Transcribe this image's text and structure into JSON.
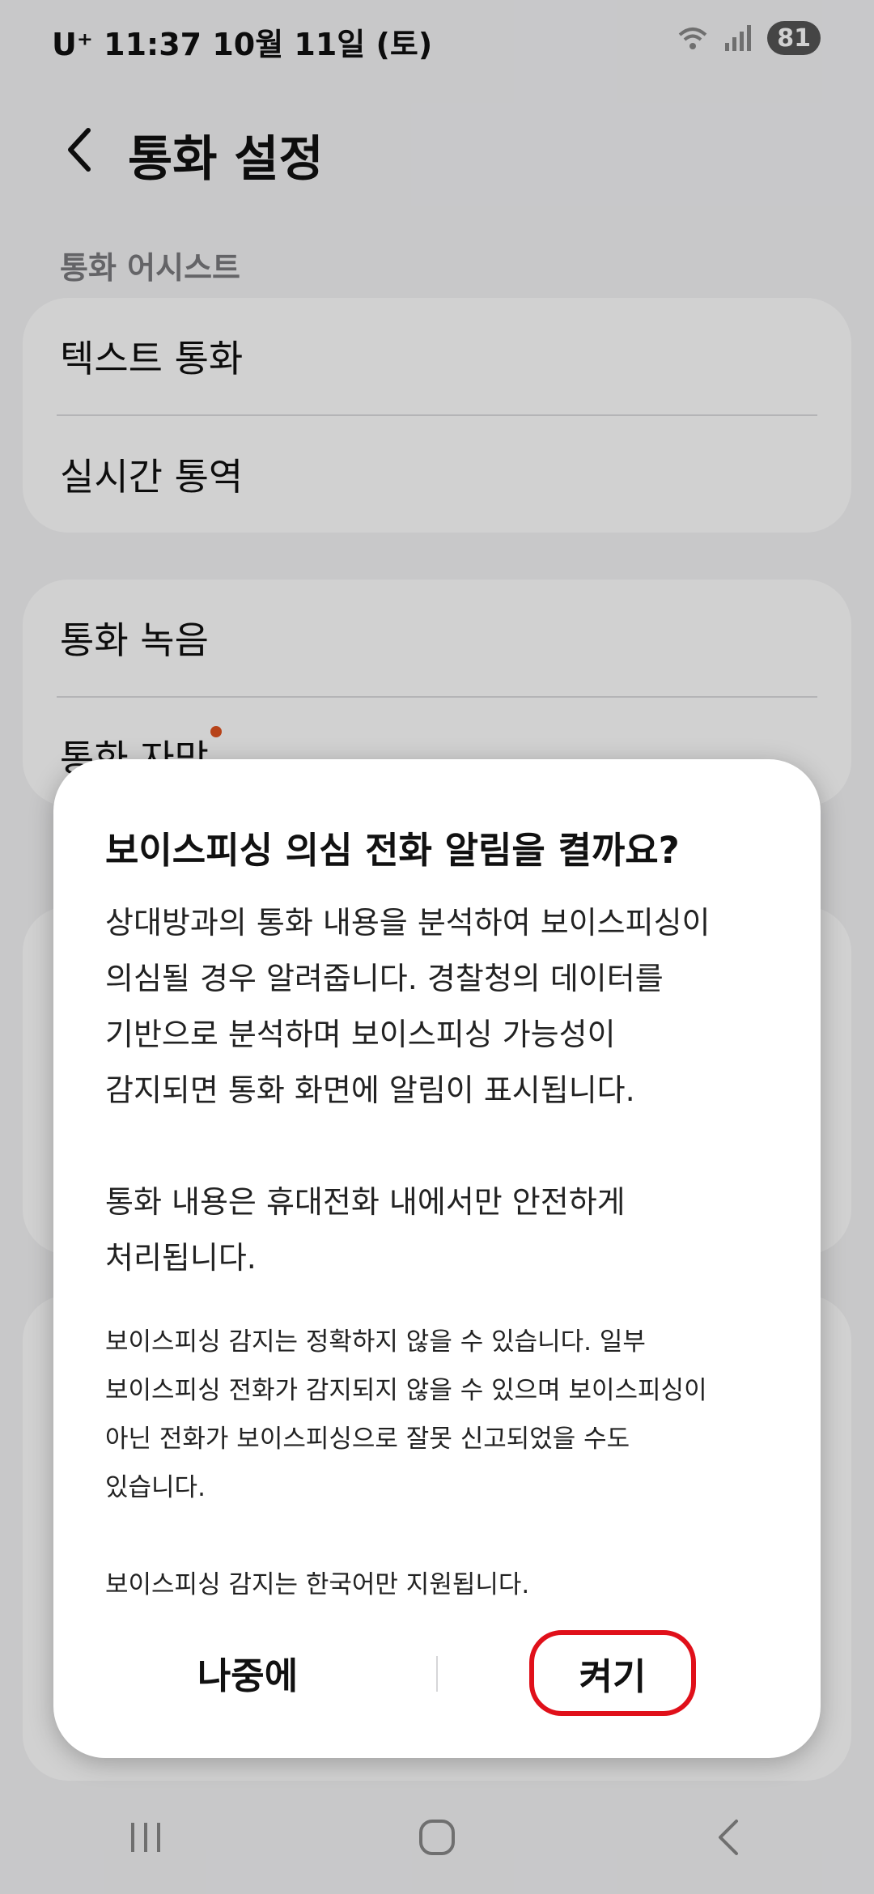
{
  "status_bar": {
    "carrier": "U⁺",
    "time": "11:37",
    "date": "10월 11일 (토)",
    "battery": "81"
  },
  "header": {
    "title": "통화 설정",
    "back_icon": "chevron-left-icon"
  },
  "section": {
    "label": "통화 어시스트"
  },
  "settings_items": [
    {
      "label": "텍스트 통화"
    },
    {
      "label": "실시간 통역"
    },
    {
      "label": "통화 녹음"
    },
    {
      "label": "통화 자막"
    }
  ],
  "dialog": {
    "title": "보이스피싱 의심 전화 알림을 켤까요?",
    "body": [
      "상대방과의 통화 내용을 분석하여 보이스피싱이\n의심될 경우 알려줍니다. 경찰청의 데이터를\n기반으로 분석하며 보이스피싱 가능성이\n감지되면 통화 화면에 알림이 표시됩니다.",
      "통화 내용은 휴대전화 내에서만 안전하게\n처리됩니다."
    ],
    "notes": [
      "보이스피싱 감지는 정확하지 않을 수 있습니다. 일부\n보이스피싱 전화가 감지되지 않을 수 있으며 보이스피싱이\n아닌 전화가 보이스피싱으로 잘못 신고되었을 수도\n있습니다.",
      "보이스피싱 감지는 한국어만 지원됩니다."
    ],
    "later_label": "나중에",
    "on_label": "켜기",
    "highlight_color": "#e0101a"
  },
  "nav": {
    "recents_icon": "recents-icon",
    "home_icon": "home-icon",
    "back_icon": "back-icon"
  }
}
